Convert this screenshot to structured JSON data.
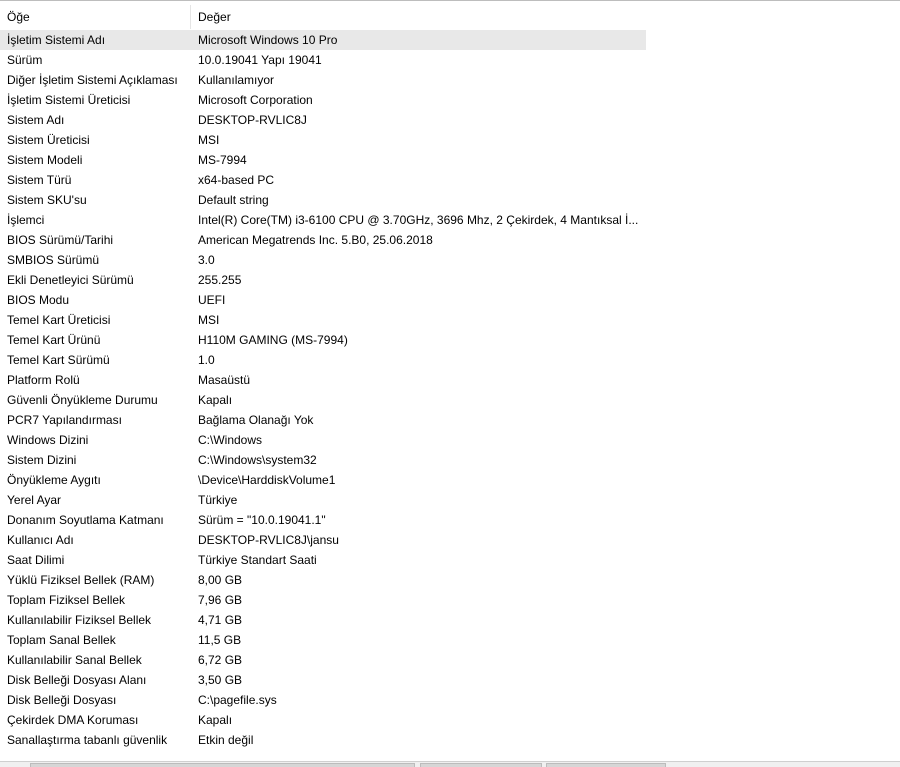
{
  "columns": {
    "item": "Öğe",
    "value": "Değer"
  },
  "rows": [
    {
      "item": "İşletim Sistemi Adı",
      "value": "Microsoft Windows 10 Pro"
    },
    {
      "item": "Sürüm",
      "value": "10.0.19041 Yapı 19041"
    },
    {
      "item": "Diğer İşletim Sistemi Açıklaması",
      "value": "Kullanılamıyor"
    },
    {
      "item": "İşletim Sistemi Üreticisi",
      "value": "Microsoft Corporation"
    },
    {
      "item": "Sistem Adı",
      "value": "DESKTOP-RVLIC8J"
    },
    {
      "item": "Sistem Üreticisi",
      "value": "MSI"
    },
    {
      "item": "Sistem Modeli",
      "value": "MS-7994"
    },
    {
      "item": "Sistem Türü",
      "value": "x64-based PC"
    },
    {
      "item": "Sistem SKU'su",
      "value": "Default string"
    },
    {
      "item": "İşlemci",
      "value": "Intel(R) Core(TM) i3-6100 CPU @ 3.70GHz, 3696 Mhz, 2 Çekirdek, 4 Mantıksal İ..."
    },
    {
      "item": "BIOS Sürümü/Tarihi",
      "value": "American Megatrends Inc. 5.B0, 25.06.2018"
    },
    {
      "item": "SMBIOS Sürümü",
      "value": "3.0"
    },
    {
      "item": "Ekli Denetleyici Sürümü",
      "value": "255.255"
    },
    {
      "item": "BIOS Modu",
      "value": "UEFI"
    },
    {
      "item": "Temel Kart Üreticisi",
      "value": "MSI"
    },
    {
      "item": "Temel Kart Ürünü",
      "value": "H110M GAMING (MS-7994)"
    },
    {
      "item": "Temel Kart Sürümü",
      "value": "1.0"
    },
    {
      "item": "Platform Rolü",
      "value": "Masaüstü"
    },
    {
      "item": "Güvenli Önyükleme Durumu",
      "value": "Kapalı"
    },
    {
      "item": "PCR7 Yapılandırması",
      "value": "Bağlama Olanağı Yok"
    },
    {
      "item": "Windows Dizini",
      "value": "C:\\Windows"
    },
    {
      "item": "Sistem Dizini",
      "value": "C:\\Windows\\system32"
    },
    {
      "item": "Önyükleme Aygıtı",
      "value": "\\Device\\HarddiskVolume1"
    },
    {
      "item": "Yerel Ayar",
      "value": "Türkiye"
    },
    {
      "item": "Donanım Soyutlama Katmanı",
      "value": "Sürüm = \"10.0.19041.1\""
    },
    {
      "item": "Kullanıcı Adı",
      "value": "DESKTOP-RVLIC8J\\jansu"
    },
    {
      "item": "Saat Dilimi",
      "value": "Türkiye Standart Saati"
    },
    {
      "item": "Yüklü Fiziksel Bellek (RAM)",
      "value": "8,00 GB"
    },
    {
      "item": "Toplam Fiziksel Bellek",
      "value": "7,96 GB"
    },
    {
      "item": "Kullanılabilir Fiziksel Bellek",
      "value": "4,71 GB"
    },
    {
      "item": "Toplam Sanal Bellek",
      "value": "11,5 GB"
    },
    {
      "item": "Kullanılabilir Sanal Bellek",
      "value": "6,72 GB"
    },
    {
      "item": "Disk Belleği Dosyası Alanı",
      "value": "3,50 GB"
    },
    {
      "item": "Disk Belleği Dosyası",
      "value": "C:\\pagefile.sys"
    },
    {
      "item": "Çekirdek DMA Koruması",
      "value": "Kapalı"
    },
    {
      "item": "Sanallaştırma tabanlı güvenlik",
      "value": "Etkin değil"
    }
  ],
  "selected_row_index": 0,
  "colors": {
    "selected_row_bg": "#e8e8e8",
    "header_divider": "#e5e5e5",
    "background": "#ffffff"
  }
}
